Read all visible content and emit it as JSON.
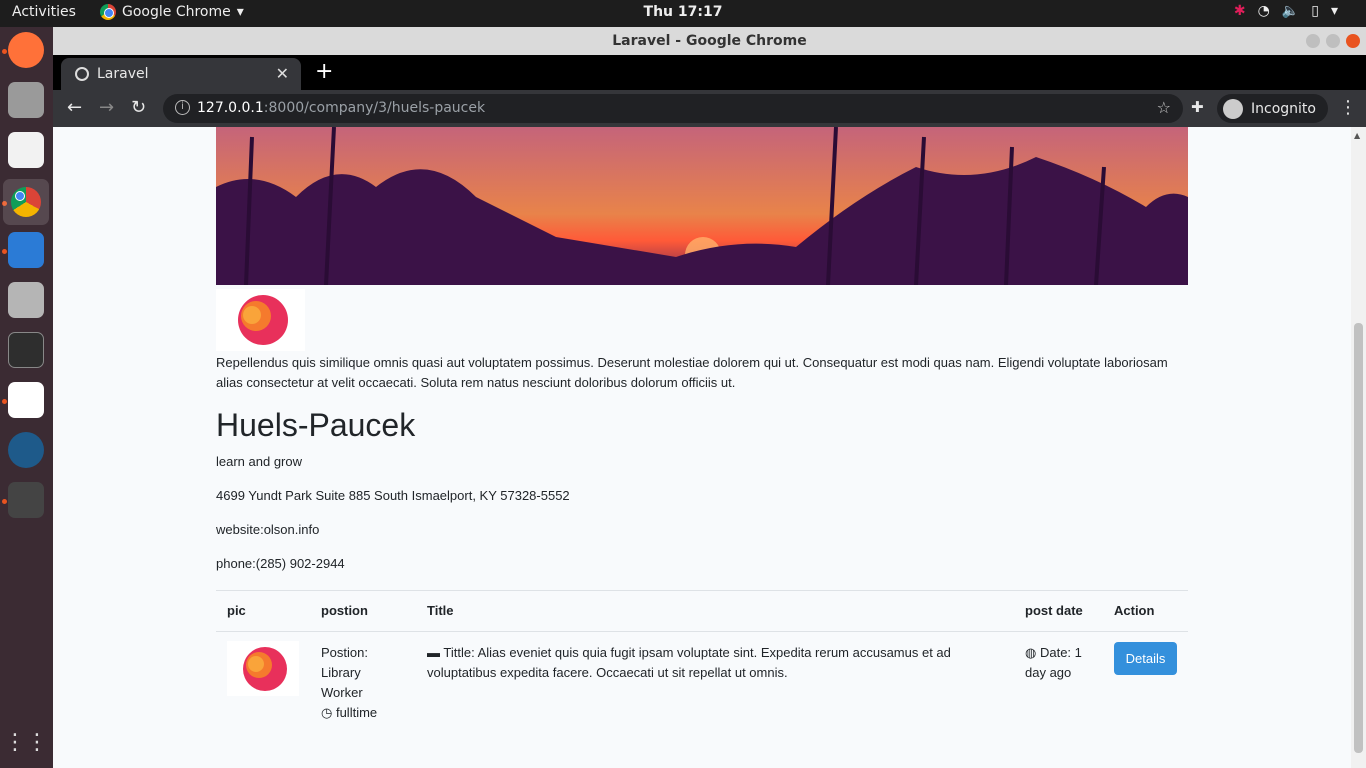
{
  "topbar": {
    "activities": "Activities",
    "app_name": "Google Chrome",
    "clock": "Thu 17:17"
  },
  "window": {
    "title": "Laravel - Google Chrome"
  },
  "tab": {
    "label": "Laravel"
  },
  "omnibox": {
    "host": "127.0.0.1",
    "path": ":8000/company/3/huels-paucek"
  },
  "incognito": {
    "label": "Incognito"
  },
  "company": {
    "about": "Repellendus quis similique omnis quasi aut voluptatem possimus. Deserunt molestiae dolorem qui ut. Consequatur est modi quas nam. Eligendi voluptate laboriosam alias consectetur at velit occaecati. Soluta rem natus nesciunt doloribus dolorum officiis ut.",
    "name": "Huels-Paucek",
    "slogan": "learn and grow",
    "address": "4699 Yundt Park Suite 885 South Ismaelport, KY 57328-5552",
    "website": "website:olson.info",
    "phone": "phone:(285) 902-2944"
  },
  "table": {
    "headers": [
      "pic",
      "postion",
      "Title",
      "post date",
      "Action"
    ],
    "row": {
      "position_label": "Postion:",
      "position_line1": "Library",
      "position_line2": "Worker",
      "type": "fulltime",
      "title": "Tittle: Alias eveniet quis quia fugit ipsam voluptate sint. Expedita rerum accusamus et ad voluptatibus expedita facere. Occaecati ut sit repellat ut omnis.",
      "date_line1": "Date: 1",
      "date_line2": "day ago",
      "action": "Details"
    }
  },
  "colors": {
    "accent": "#3490dc",
    "page_bg": "#f8fafc",
    "dock_bg": "#3b2b33"
  }
}
